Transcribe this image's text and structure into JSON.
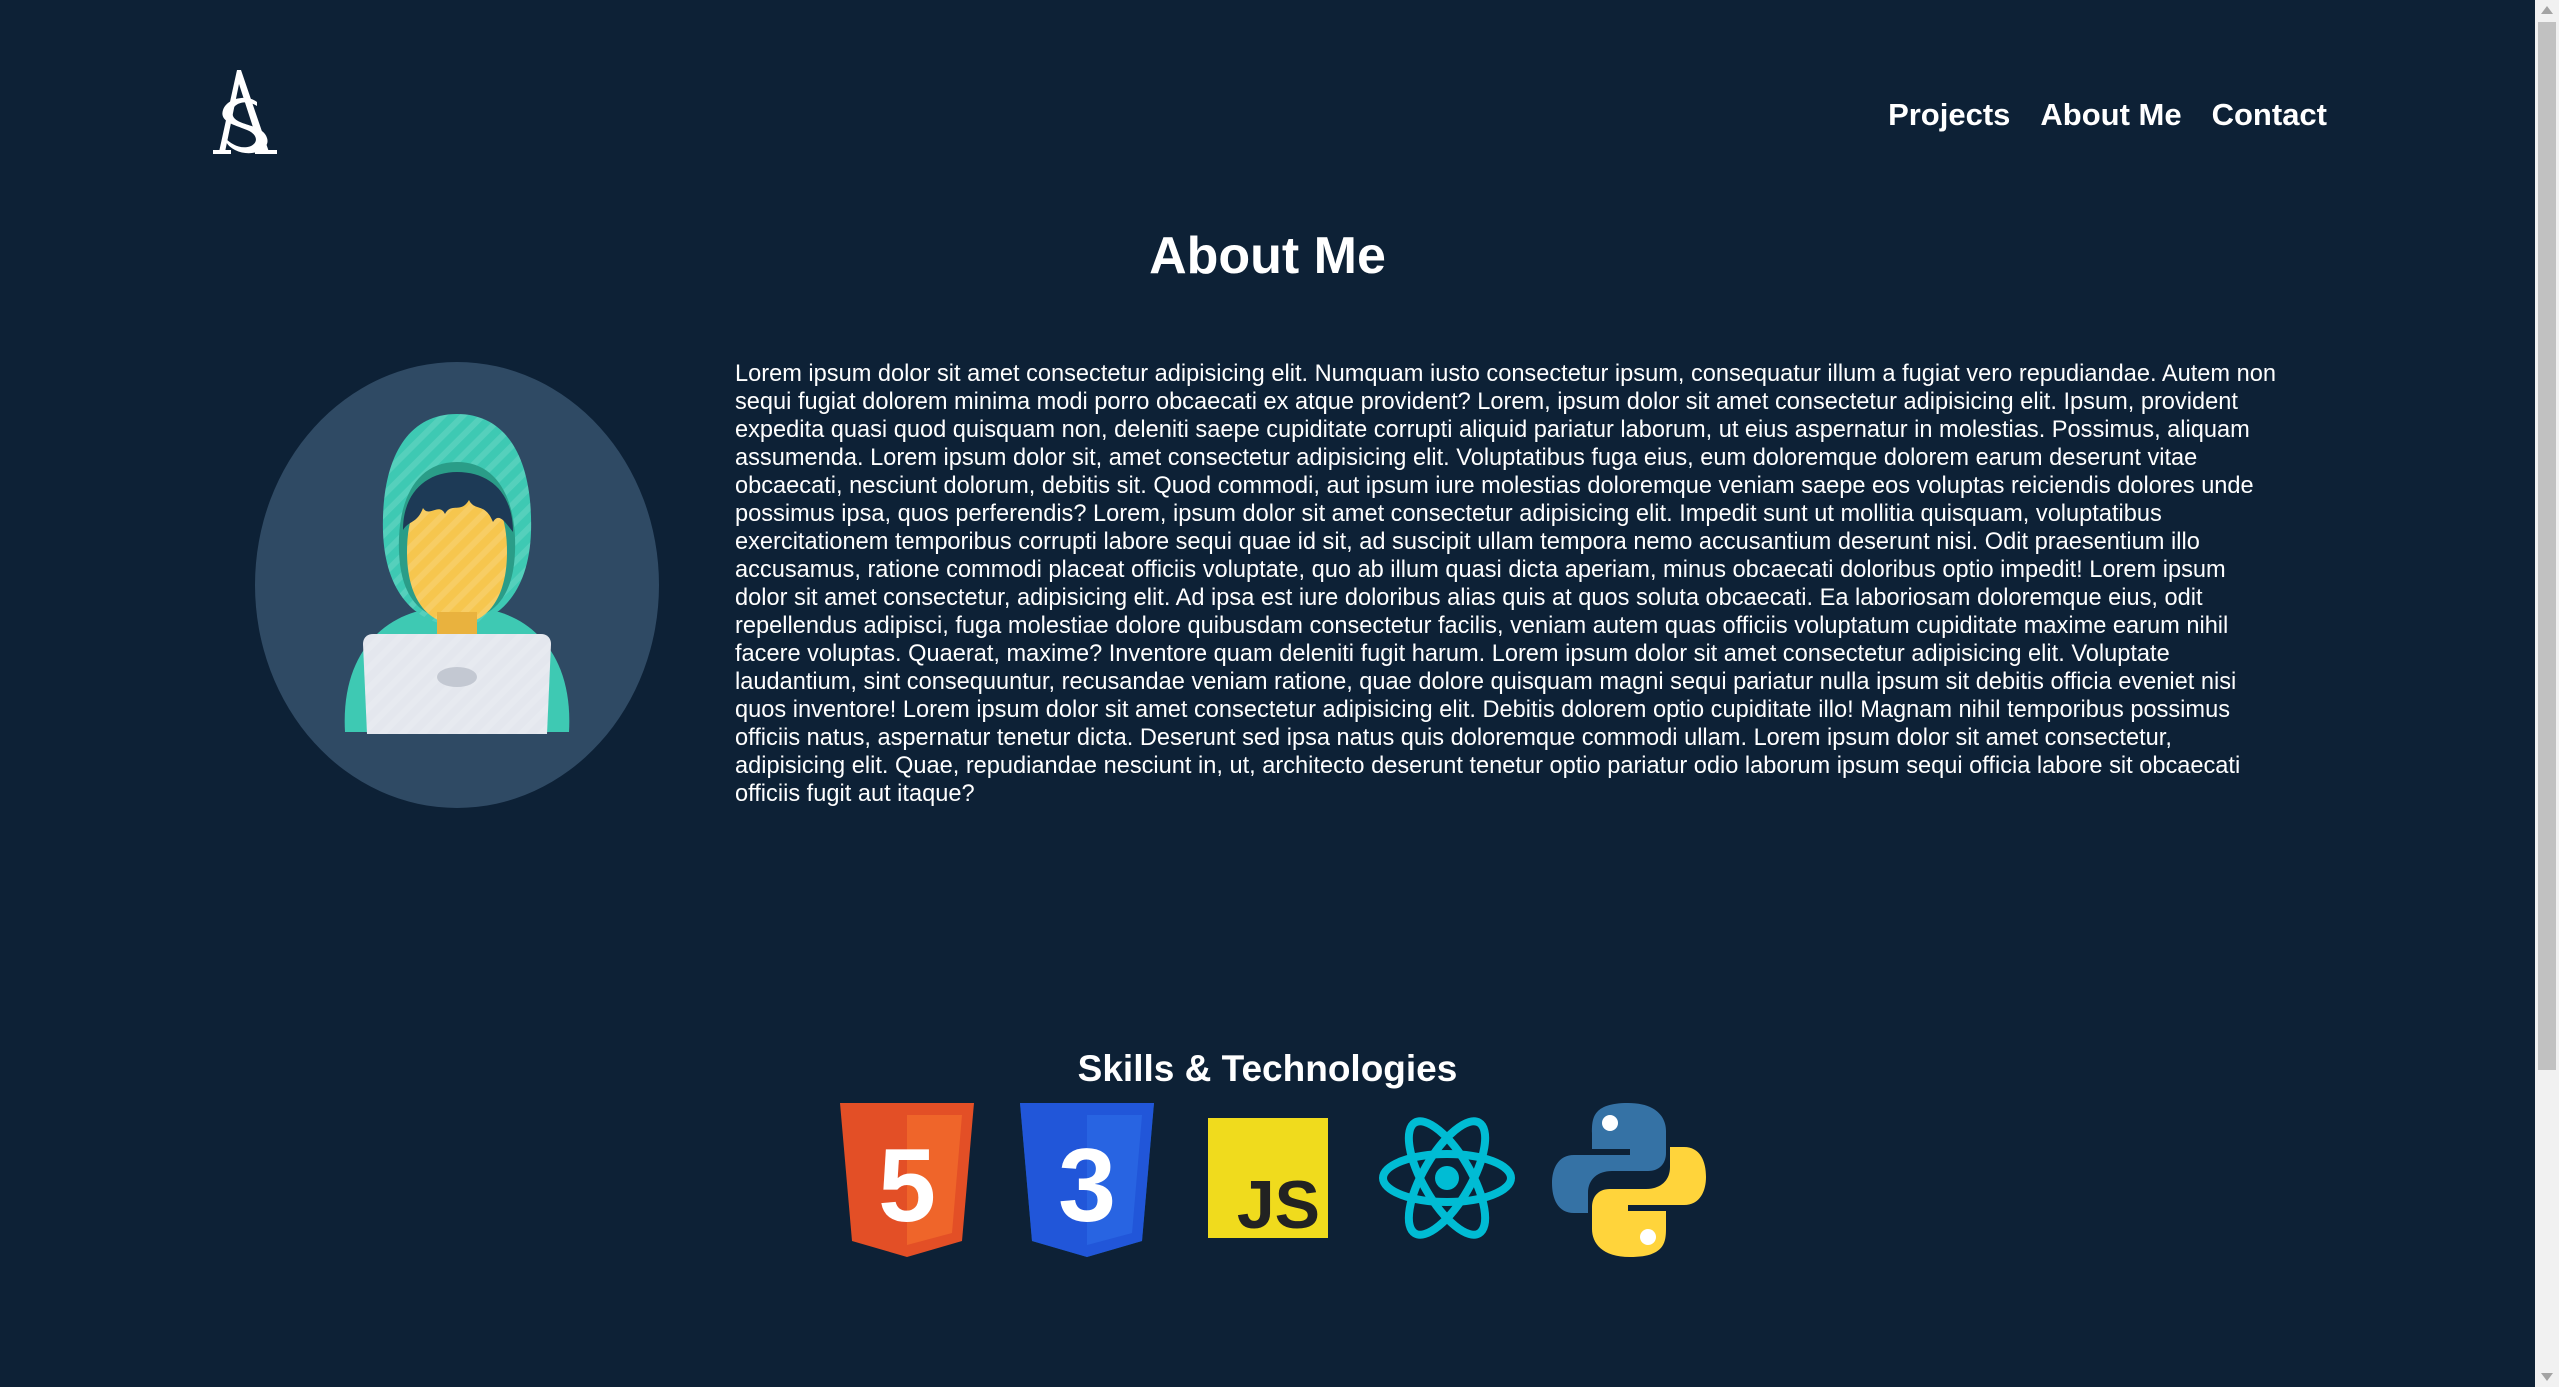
{
  "nav": {
    "items": [
      {
        "label": "Projects"
      },
      {
        "label": "About Me"
      },
      {
        "label": "Contact"
      }
    ]
  },
  "main": {
    "title": "About Me",
    "bio": "Lorem ipsum dolor sit amet consectetur adipisicing elit. Numquam iusto consectetur ipsum, consequatur illum a fugiat vero repudiandae. Autem non sequi fugiat dolorem minima modi porro obcaecati ex atque provident? Lorem, ipsum dolor sit amet consectetur adipisicing elit. Ipsum, provident expedita quasi quod quisquam non, deleniti saepe cupiditate corrupti aliquid pariatur laborum, ut eius aspernatur in molestias. Possimus, aliquam assumenda. Lorem ipsum dolor sit, amet consectetur adipisicing elit. Voluptatibus fuga eius, eum doloremque dolorem earum deserunt vitae obcaecati, nesciunt dolorum, debitis sit. Quod commodi, aut ipsum iure molestias doloremque veniam saepe eos voluptas reiciendis dolores unde possimus ipsa, quos perferendis? Lorem, ipsum dolor sit amet consectetur adipisicing elit. Impedit sunt ut mollitia quisquam, voluptatibus exercitationem temporibus corrupti labore sequi quae id sit, ad suscipit ullam tempora nemo accusantium deserunt nisi. Odit praesentium illo accusamus, ratione commodi placeat officiis voluptate, quo ab illum quasi dicta aperiam, minus obcaecati doloribus optio impedit! Lorem ipsum dolor sit amet consectetur, adipisicing elit. Ad ipsa est iure doloribus alias quis at quos soluta obcaecati. Ea laboriosam doloremque eius, odit repellendus adipisci, fuga molestiae dolore quibusdam consectetur facilis, veniam autem quas officiis voluptatum cupiditate maxime earum nihil facere voluptas. Quaerat, maxime? Inventore quam deleniti fugit harum. Lorem ipsum dolor sit amet consectetur adipisicing elit. Voluptate laudantium, sint consequuntur, recusandae veniam ratione, quae dolore quisquam magni sequi pariatur nulla ipsum sit debitis officia eveniet nisi quos inventore! Lorem ipsum dolor sit amet consectetur adipisicing elit. Debitis dolorem optio cupiditate illo! Magnam nihil temporibus possimus officiis natus, aspernatur tenetur dicta. Deserunt sed ipsa natus quis doloremque commodi ullam. Lorem ipsum dolor sit amet consectetur, adipisicing elit. Quae, repudiandae nesciunt in, ut, architecto deserunt tenetur optio pariatur odio laborum ipsum sequi officia labore sit obcaecati officiis fugit aut itaque?"
  },
  "skills": {
    "title": "Skills & Technologies",
    "items": [
      {
        "icon": "html5-icon",
        "text": "5"
      },
      {
        "icon": "css3-icon",
        "text": "3"
      },
      {
        "icon": "javascript-icon",
        "text": "JS"
      },
      {
        "icon": "react-icon"
      },
      {
        "icon": "python-icon"
      }
    ]
  },
  "colors": {
    "background": "#0d2136",
    "html_orange": "#e34f26",
    "css_blue": "#1572b6",
    "js_yellow": "#f0db1d",
    "react_cyan": "#00bcd4",
    "python_blue": "#3572a5",
    "python_yellow": "#ffd43b"
  }
}
